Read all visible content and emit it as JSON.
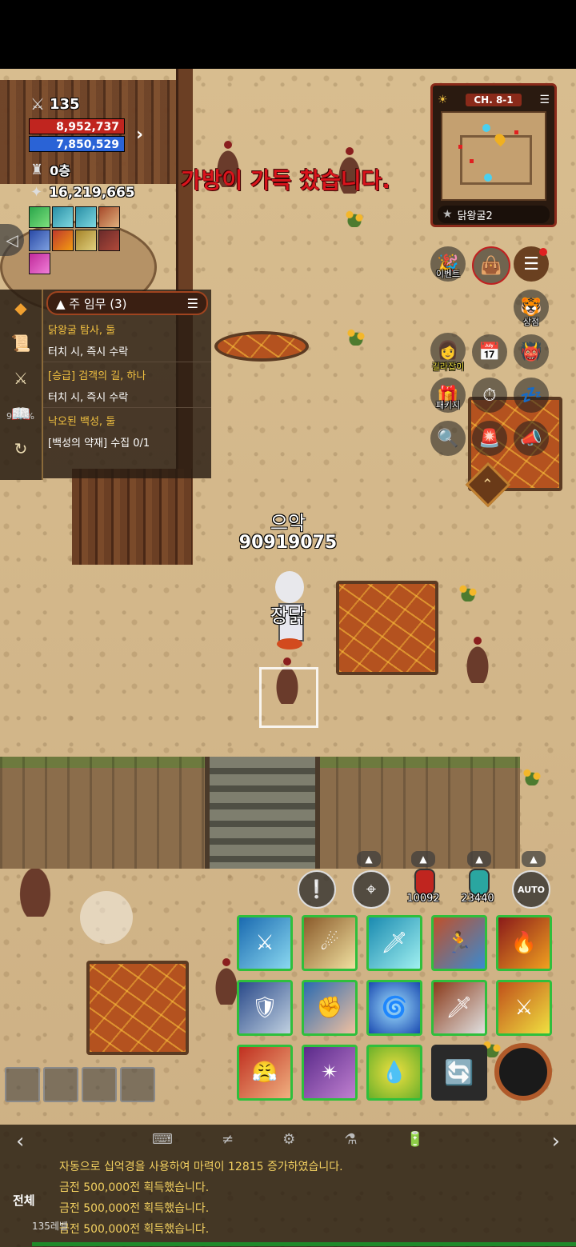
{
  "player": {
    "attack": "135",
    "hp": "8,952,737",
    "mp": "7,850,529",
    "floor": "0층",
    "gold": "16,219,665"
  },
  "alert": "가방이 가득 찼습니다.",
  "minimap": {
    "chapter": "CH. 8-1",
    "location": "닭왕굴2"
  },
  "right_menu": {
    "event": "이벤트",
    "shop": "상점",
    "guide": "길라잡이",
    "package": "패키지"
  },
  "quest": {
    "header": "▲ 주 임무 (3)",
    "items": [
      {
        "title": "닭왕굴 탐사, 둘",
        "sub": "터치 시, 즉시 수락"
      },
      {
        "title": "[승급] 검객의 길, 하나",
        "sub": "터치 시, 즉시 수락"
      },
      {
        "title": "낙오된 백성, 둘",
        "sub": "[백성의 약재] 수집 0/1"
      }
    ]
  },
  "side_percent": "92.4%",
  "enemy": {
    "name": "으악",
    "hp": "90919075"
  },
  "player_name": "장닭",
  "potions": {
    "red": "10092",
    "blue": "23440"
  },
  "auto_label": "AUTO",
  "chat": {
    "tab": "전체",
    "lines": [
      "자동으로 십억경을 사용하여 마력이 12815 증가하였습니다.",
      "금전 500,000전 획득했습니다.",
      "금전 500,000전 획득했습니다.",
      "금전 500,000전 획득했습니다."
    ],
    "footer": "135레벨"
  },
  "colors": {
    "hp": "#c0251f",
    "mp": "#2a63d6",
    "skill_border": "#2fbf3c",
    "quest_title": "#f0c040",
    "alert": "#d8141c"
  }
}
